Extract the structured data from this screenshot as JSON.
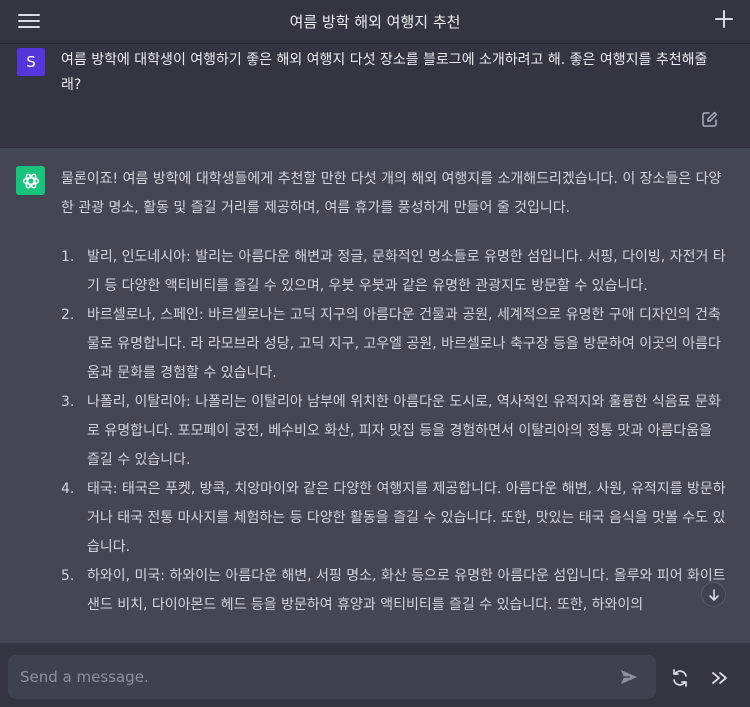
{
  "header": {
    "title": "여름 방학 해외 여행지 추천",
    "menu_icon": "hamburger-menu-icon",
    "new_chat_icon": "plus-icon"
  },
  "user_message": {
    "avatar_letter": "S",
    "text": "여름 방학에 대학생이 여행하기 좋은 해외 여행지 다섯 장소를 블로그에 소개하려고 해. 좋은 여행지를 추천해줄래?"
  },
  "assistant_message": {
    "intro": "물론이죠! 여름 방학에 대학생들에게 추천할 만한 다섯 개의 해외 여행지를 소개해드리겠습니다. 이 장소들은 다양한 관광 명소, 활동 및 즐길 거리를 제공하며, 여름 휴가를 풍성하게 만들어 줄 것입니다.",
    "items": [
      {
        "num": "1.",
        "text": "발리, 인도네시아: 발리는 아름다운 해변과 정글, 문화적인 명소들로 유명한 섬입니다. 서핑, 다이빙, 자전거 타기 등 다양한 액티비티를 즐길 수 있으며, 우붓 우붓과 같은 유명한 관광지도 방문할 수 있습니다."
      },
      {
        "num": "2.",
        "text": "바르셀로나, 스페인: 바르셀로나는 고딕 지구의 아름다운 건물과 공원, 세계적으로 유명한 구애 디자인의 건축물로 유명합니다. 라 라모브라 성당, 고딕 지구, 고우엘 공원, 바르셀로나 축구장 등을 방문하여 이곳의 아름다움과 문화를 경험할 수 있습니다."
      },
      {
        "num": "3.",
        "text": "나폴리, 이탈리아: 나폴리는 이탈리아 남부에 위치한 아름다운 도시로, 역사적인 유적지와 훌륭한 식음료 문화로 유명합니다. 포모페이 궁전, 베수비오 화산, 피자 맛집 등을 경험하면서 이탈리아의 정통 맛과 아름다움을 즐길 수 있습니다."
      },
      {
        "num": "4.",
        "text": "태국: 태국은 푸켓, 방콕, 치앙마이와 같은 다양한 여행지를 제공합니다. 아름다운 해변, 사원, 유적지를 방문하거나 태국 전통 마사지를 체험하는 등 다양한 활동을 즐길 수 있습니다. 또한, 맛있는 태국 음식을 맛볼 수도 있습니다."
      },
      {
        "num": "5.",
        "text": "하와이, 미국: 하와이는 아름다운 해변, 서핑 명소, 화산 등으로 유명한 아름다운 섬입니다. 올루와 피어 화이트샌드 비치, 다이아몬드 헤드 등을 방문하여 휴양과 액티비티를 즐길 수 있습니다. 또한, 하와이의"
      }
    ]
  },
  "composer": {
    "placeholder": "Send a message."
  },
  "icons": {
    "edit": "edit-icon",
    "openai_logo": "openai-logo-icon",
    "scroll_down": "arrow-down-icon",
    "send": "send-icon",
    "regenerate": "refresh-icon",
    "continue": "fast-forward-icon"
  },
  "colors": {
    "background": "#343541",
    "assistant_bg": "#444654",
    "user_avatar": "#5436da",
    "assistant_avatar": "#19c37d",
    "input_bg": "#40414f"
  }
}
